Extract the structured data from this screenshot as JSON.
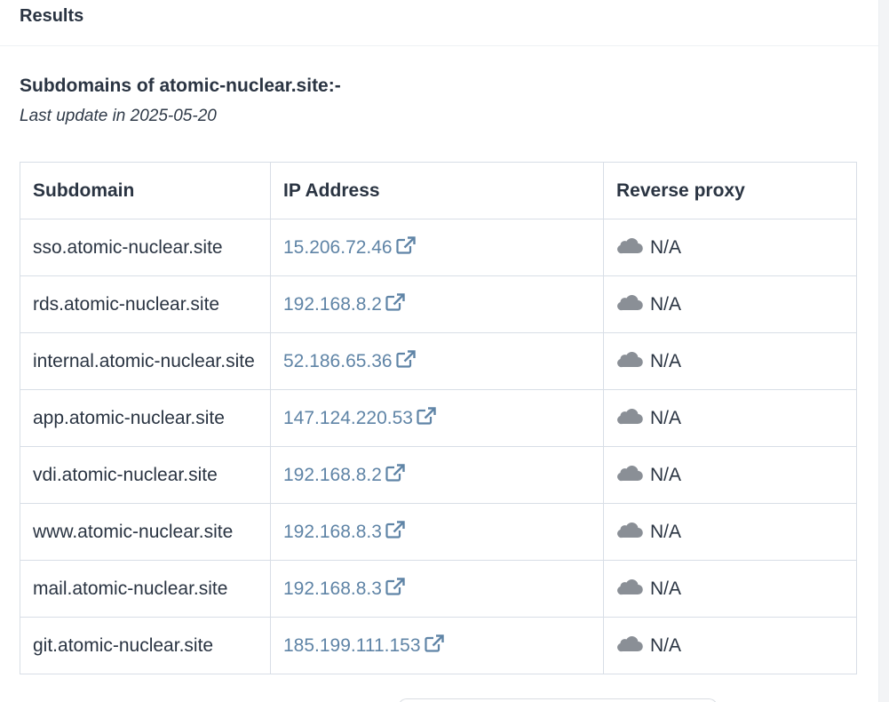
{
  "header": {
    "title": "Results"
  },
  "subdomains_section": {
    "title": "Subdomains of atomic-nuclear.site:-",
    "last_update": "Last update in 2025-05-20"
  },
  "table": {
    "columns": [
      "Subdomain",
      "IP Address",
      "Reverse proxy"
    ],
    "rows": [
      {
        "subdomain": "sso.atomic-nuclear.site",
        "ip": "15.206.72.46",
        "proxy": "N/A"
      },
      {
        "subdomain": "rds.atomic-nuclear.site",
        "ip": "192.168.8.2",
        "proxy": "N/A"
      },
      {
        "subdomain": "internal.atomic-nuclear.site",
        "ip": "52.186.65.36",
        "proxy": "N/A"
      },
      {
        "subdomain": "app.atomic-nuclear.site",
        "ip": "147.124.220.53",
        "proxy": "N/A"
      },
      {
        "subdomain": "vdi.atomic-nuclear.site",
        "ip": "192.168.8.2",
        "proxy": "N/A"
      },
      {
        "subdomain": "www.atomic-nuclear.site",
        "ip": "192.168.8.3",
        "proxy": "N/A"
      },
      {
        "subdomain": "mail.atomic-nuclear.site",
        "ip": "192.168.8.3",
        "proxy": "N/A"
      },
      {
        "subdomain": "git.atomic-nuclear.site",
        "ip": "185.199.111.153",
        "proxy": "N/A"
      }
    ]
  },
  "icons": {
    "ip_link_icon": "external-link-icon",
    "proxy_icon": "cloud-icon"
  },
  "colors": {
    "link": "#5f84a6",
    "text": "#2a3442",
    "cloud": "#8a8f96",
    "border": "#d8dee6"
  }
}
